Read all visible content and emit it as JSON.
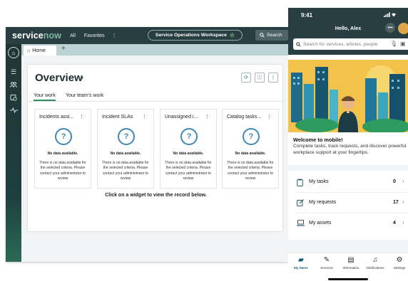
{
  "desktop": {
    "logo": {
      "service": "service",
      "now": "now"
    },
    "nav": {
      "all": "All",
      "favorites": "Favorites",
      "more": "⋮"
    },
    "workspace": {
      "label": "Service Operations Workspace",
      "star": "☆"
    },
    "search": {
      "label": "Search"
    },
    "tabs": {
      "home": "Home",
      "add": "+"
    },
    "overview": {
      "title": "Overview",
      "subtabs": [
        "Your work",
        "Your team's work"
      ],
      "cards": [
        {
          "title": "Incidents assi...",
          "no_data": "No data available.",
          "message": "There is no data available for the selected criteria. Please contact your administrator to review"
        },
        {
          "title": "Incident SLAs",
          "no_data": "No data available.",
          "message": "There is no data available for the selected criteria. Please contact your administrator to review"
        },
        {
          "title": "Unassigned i...",
          "no_data": "No data available.",
          "message": "There is no data available for the selected criteria. Please contact your administrator to review"
        },
        {
          "title": "Catalog tasks...",
          "no_data": "No data available.",
          "message": "There is no data available for the selected criteria. Please contact your administrator to review"
        }
      ],
      "footer": "Click on a widget to view the record below."
    }
  },
  "mobile": {
    "status_time": "9:41",
    "greeting": "Hello, Alex",
    "search_placeholder": "Search for services, articles, people",
    "welcome_title": "Welcome to mobile!",
    "welcome_text": "Complete tasks, track requests, and discover powerful workplace support at your fingertips.",
    "rows": [
      {
        "label": "My tasks",
        "count": "0"
      },
      {
        "label": "My requests",
        "count": "17"
      },
      {
        "label": "My assets",
        "count": "4"
      }
    ],
    "nav": [
      "My items",
      "Services",
      "Information",
      "Notifications",
      "Settings"
    ]
  },
  "colors": {
    "header": "#293e40",
    "accent_green": "#81b5a1",
    "icon_blue": "#3f88b5"
  }
}
